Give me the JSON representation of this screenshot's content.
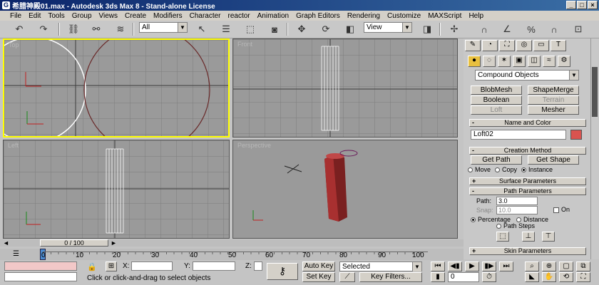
{
  "window": {
    "title": "希腊神殿01.max - Autodesk 3ds Max 8 - Stand-alone License",
    "buttons": [
      "_",
      "□",
      "×"
    ]
  },
  "menu": [
    "File",
    "Edit",
    "Tools",
    "Group",
    "Views",
    "Create",
    "Modifiers",
    "Character",
    "reactor",
    "Animation",
    "Graph Editors",
    "Rendering",
    "Customize",
    "MAXScript",
    "Help"
  ],
  "toolbar": {
    "selection_filter": "All",
    "reference_coord": "View"
  },
  "viewports": {
    "top": {
      "label": "Top"
    },
    "front": {
      "label": "Front"
    },
    "left": {
      "label": "Left"
    },
    "perspective": {
      "label": "Perspective"
    }
  },
  "command_panel": {
    "category": "Compound Objects",
    "object_types": [
      "BlobMesh",
      "ShapeMerge",
      "Boolean",
      "Terrain",
      "Loft",
      "Mesher"
    ],
    "name_and_color": {
      "title": "Name and Color",
      "name": "Loft02",
      "color": "#d9534f"
    },
    "creation_method": {
      "title": "Creation Method",
      "get_path": "Get Path",
      "get_shape": "Get Shape",
      "move": "Move",
      "copy": "Copy",
      "instance": "Instance"
    },
    "surface_parameters": {
      "title": "Surface Parameters"
    },
    "path_parameters": {
      "title": "Path Parameters",
      "path_label": "Path:",
      "path_value": "3.0",
      "snap_label": "Snap:",
      "snap_value": "10.0",
      "on_label": "On",
      "percentage": "Percentage",
      "distance": "Distance",
      "path_steps": "Path Steps"
    },
    "skin_parameters": {
      "title": "Skin Parameters"
    }
  },
  "time_slider": {
    "label": "0 / 100"
  },
  "track_ticks": [
    "0",
    "10",
    "20",
    "30",
    "40",
    "50",
    "60",
    "70",
    "80",
    "90",
    "100"
  ],
  "status": {
    "x_label": "X:",
    "y_label": "Y:",
    "z_label": "Z:",
    "auto_key": "Auto Key",
    "set_key": "Set Key",
    "key_mode": "Selected",
    "key_filters": "Key Filters...",
    "prompt": "Click or click-and-drag to select objects",
    "frame": "0"
  }
}
